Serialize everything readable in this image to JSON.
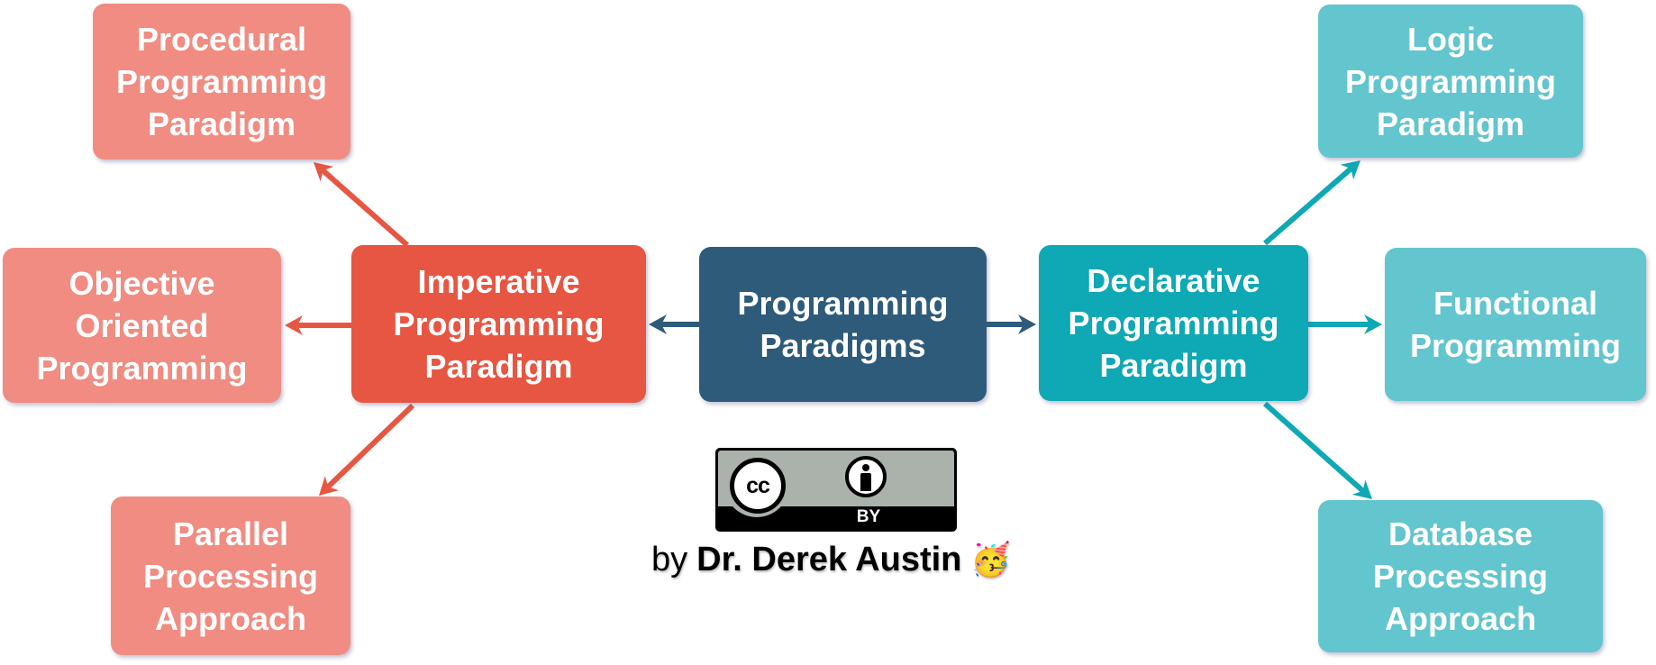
{
  "diagram": {
    "title": "Programming Paradigms",
    "colors": {
      "root": "#2e5b7a",
      "imperative": "#e75642",
      "imperative_child": "#f08c81",
      "declarative": "#0fa8b5",
      "declarative_child": "#63c5ce"
    },
    "nodes": {
      "root": {
        "label": "Programming\nParadigms"
      },
      "imperative": {
        "label": "Imperative\nProgramming\nParadigm"
      },
      "declarative": {
        "label": "Declarative\nProgramming\nParadigm"
      },
      "procedural": {
        "label": "Procedural\nProgramming\nParadigm"
      },
      "object_oriented": {
        "label": "Objective\nOriented\nProgramming"
      },
      "parallel": {
        "label": "Parallel\nProcessing\nApproach"
      },
      "logic": {
        "label": "Logic\nProgramming\nParadigm"
      },
      "functional": {
        "label": "Functional\nProgramming"
      },
      "database": {
        "label": "Database\nProcessing\nApproach"
      }
    },
    "edges": [
      {
        "from": "root",
        "to": "imperative"
      },
      {
        "from": "root",
        "to": "declarative"
      },
      {
        "from": "imperative",
        "to": "procedural"
      },
      {
        "from": "imperative",
        "to": "object_oriented"
      },
      {
        "from": "imperative",
        "to": "parallel"
      },
      {
        "from": "declarative",
        "to": "logic"
      },
      {
        "from": "declarative",
        "to": "functional"
      },
      {
        "from": "declarative",
        "to": "database"
      }
    ]
  },
  "license": {
    "badge_cc": "cc",
    "badge_by": "BY",
    "icons": [
      "creative-commons-icon",
      "attribution-person-icon"
    ]
  },
  "credit": {
    "prefix": "by",
    "author": "Dr. Derek Austin",
    "emoji": "🥳"
  }
}
